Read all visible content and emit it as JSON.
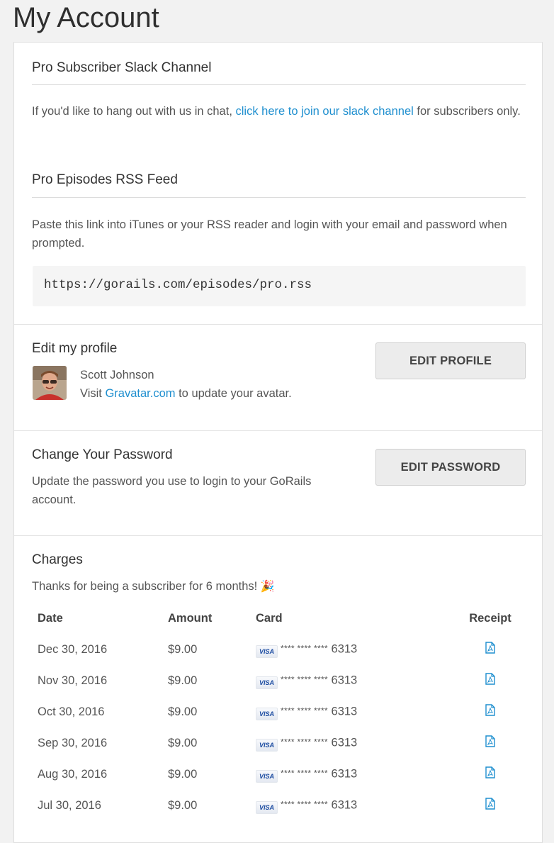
{
  "page": {
    "title": "My Account"
  },
  "slack": {
    "heading": "Pro Subscriber Slack Channel",
    "text_before": "If you'd like to hang out with us in chat, ",
    "link_text": "click here to join our slack channel",
    "text_after": " for subscribers only."
  },
  "rss": {
    "heading": "Pro Episodes RSS Feed",
    "description": "Paste this link into iTunes or your RSS reader and login with your email and password when prompted.",
    "url": "https://gorails.com/episodes/pro.rss"
  },
  "profile": {
    "heading": "Edit my profile",
    "name": "Scott Johnson",
    "visit_text": "Visit ",
    "gravatar_link": "Gravatar.com",
    "avatar_suffix": " to update your avatar.",
    "button_label": "EDIT PROFILE"
  },
  "password": {
    "heading": "Change Your Password",
    "description": "Update the password you use to login to your GoRails account.",
    "button_label": "EDIT PASSWORD"
  },
  "charges": {
    "heading": "Charges",
    "thanks_text": "Thanks for being a subscriber for 6 months! ",
    "emoji": "🎉",
    "columns": [
      "Date",
      "Amount",
      "Card",
      "Receipt"
    ],
    "rows": [
      {
        "date": "Dec 30, 2016",
        "amount": "$9.00",
        "card_brand": "VISA",
        "card_mask": "**** **** ****",
        "card_last4": "6313"
      },
      {
        "date": "Nov 30, 2016",
        "amount": "$9.00",
        "card_brand": "VISA",
        "card_mask": "**** **** ****",
        "card_last4": "6313"
      },
      {
        "date": "Oct 30, 2016",
        "amount": "$9.00",
        "card_brand": "VISA",
        "card_mask": "**** **** ****",
        "card_last4": "6313"
      },
      {
        "date": "Sep 30, 2016",
        "amount": "$9.00",
        "card_brand": "VISA",
        "card_mask": "**** **** ****",
        "card_last4": "6313"
      },
      {
        "date": "Aug 30, 2016",
        "amount": "$9.00",
        "card_brand": "VISA",
        "card_mask": "**** **** ****",
        "card_last4": "6313"
      },
      {
        "date": "Jul 30, 2016",
        "amount": "$9.00",
        "card_brand": "VISA",
        "card_mask": "**** **** ****",
        "card_last4": "6313"
      }
    ]
  },
  "colors": {
    "link": "#1f8fcf",
    "background": "#f2f2f2",
    "card": "#ffffff",
    "button": "#ececec"
  },
  "icons": {
    "receipt": "file-pdf-icon",
    "card": "visa-card-icon"
  }
}
